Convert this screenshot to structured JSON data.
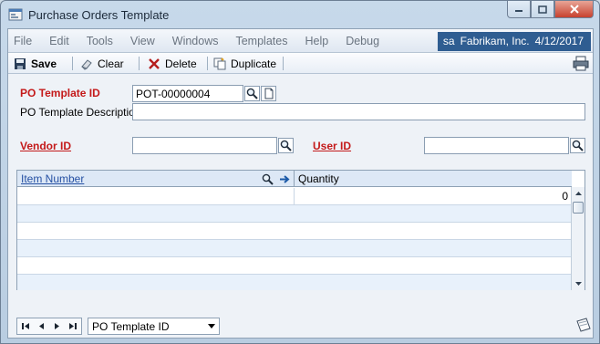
{
  "window": {
    "title": "Purchase Orders Template"
  },
  "menu": [
    "File",
    "Edit",
    "Tools",
    "View",
    "Windows",
    "Templates",
    "Help",
    "Debug"
  ],
  "userinfo": {
    "user": "sa",
    "company": "Fabrikam, Inc.",
    "date": "4/12/2017"
  },
  "toolbar": {
    "save": "Save",
    "clear": "Clear",
    "delete": "Delete",
    "duplicate": "Duplicate"
  },
  "form": {
    "po_template_id_label": "PO Template ID",
    "po_template_id_value": "POT-00000004",
    "description_label": "PO Template Description",
    "description_value": "",
    "vendor_id_label": "Vendor ID",
    "vendor_id_value": "",
    "user_id_label": "User ID",
    "user_id_value": ""
  },
  "grid": {
    "columns": [
      "Item Number",
      "Quantity"
    ],
    "rows": [
      {
        "item": "",
        "quantity": "0"
      }
    ]
  },
  "browse": {
    "sort_by": "PO Template ID"
  }
}
